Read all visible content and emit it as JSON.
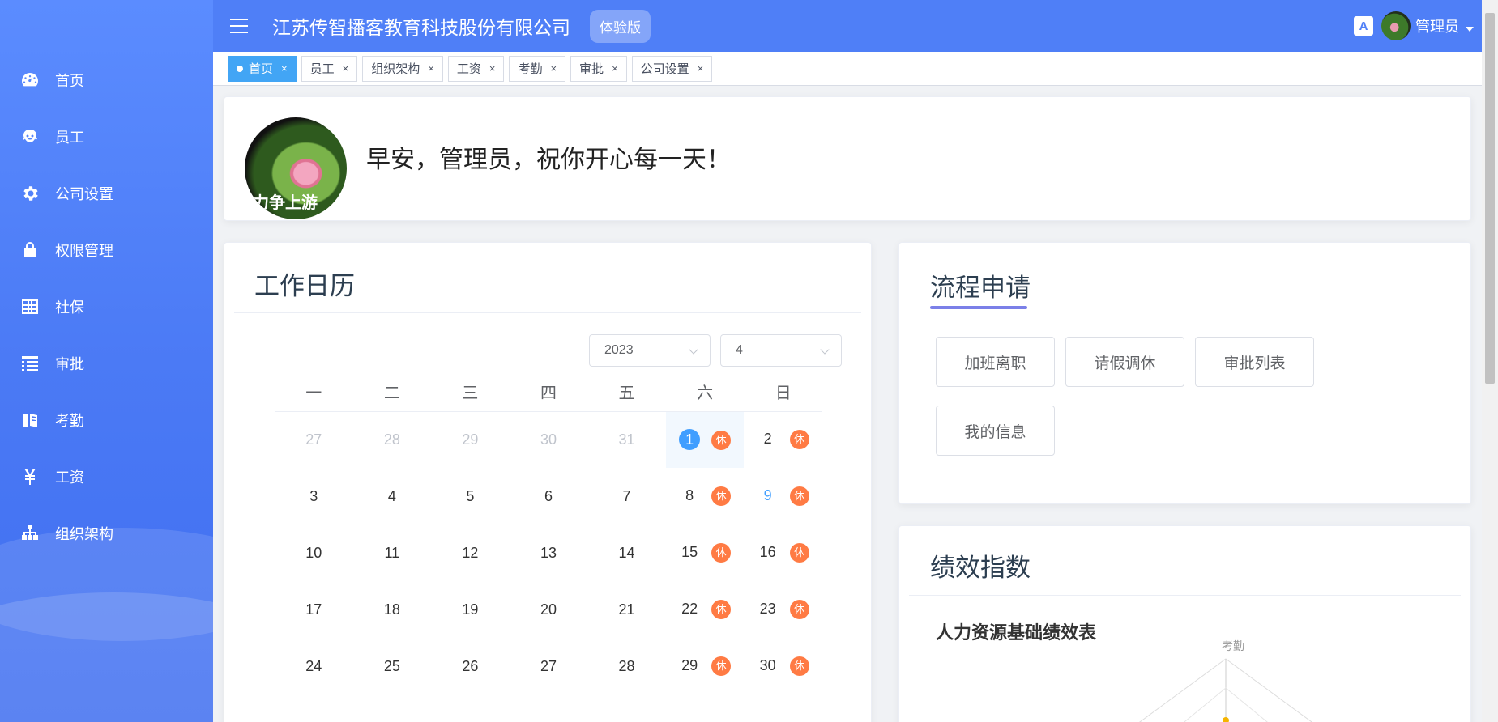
{
  "header": {
    "company": "江苏传智播客教育科技股份有限公司",
    "badge": "体验版",
    "username": "管理员",
    "lang_icon": "translate-icon"
  },
  "sidebar": {
    "items": [
      {
        "label": "首页",
        "icon": "dashboard-icon"
      },
      {
        "label": "员工",
        "icon": "people-icon"
      },
      {
        "label": "公司设置",
        "icon": "gear-icon"
      },
      {
        "label": "权限管理",
        "icon": "lock-icon"
      },
      {
        "label": "社保",
        "icon": "table-icon"
      },
      {
        "label": "审批",
        "icon": "tree-table-icon"
      },
      {
        "label": "考勤",
        "icon": "skill-icon"
      },
      {
        "label": "工资",
        "icon": "money-icon"
      },
      {
        "label": "组织架构",
        "icon": "tree-icon"
      }
    ]
  },
  "tags": [
    {
      "label": "首页",
      "active": true
    },
    {
      "label": "员工"
    },
    {
      "label": "组织架构"
    },
    {
      "label": "工资"
    },
    {
      "label": "考勤"
    },
    {
      "label": "审批"
    },
    {
      "label": "公司设置"
    }
  ],
  "welcome": {
    "avatar_text": "力争上游",
    "greeting": "早安，管理员，祝你开心每一天！"
  },
  "calendar": {
    "title": "工作日历",
    "year": "2023",
    "month": "4",
    "weekdays": [
      "一",
      "二",
      "三",
      "四",
      "五",
      "六",
      "日"
    ],
    "rest_label": "休",
    "weeks": [
      [
        {
          "d": "27",
          "prev": true
        },
        {
          "d": "28",
          "prev": true
        },
        {
          "d": "29",
          "prev": true
        },
        {
          "d": "30",
          "prev": true
        },
        {
          "d": "31",
          "prev": true
        },
        {
          "d": "1",
          "rest": true,
          "today": true
        },
        {
          "d": "2",
          "rest": true
        }
      ],
      [
        {
          "d": "3"
        },
        {
          "d": "4"
        },
        {
          "d": "5"
        },
        {
          "d": "6"
        },
        {
          "d": "7"
        },
        {
          "d": "8",
          "rest": true
        },
        {
          "d": "9",
          "rest": true,
          "blue": true
        }
      ],
      [
        {
          "d": "10"
        },
        {
          "d": "11"
        },
        {
          "d": "12"
        },
        {
          "d": "13"
        },
        {
          "d": "14"
        },
        {
          "d": "15",
          "rest": true
        },
        {
          "d": "16",
          "rest": true
        }
      ],
      [
        {
          "d": "17"
        },
        {
          "d": "18"
        },
        {
          "d": "19"
        },
        {
          "d": "20"
        },
        {
          "d": "21"
        },
        {
          "d": "22",
          "rest": true
        },
        {
          "d": "23",
          "rest": true
        }
      ],
      [
        {
          "d": "24"
        },
        {
          "d": "25"
        },
        {
          "d": "26"
        },
        {
          "d": "27"
        },
        {
          "d": "28"
        },
        {
          "d": "29",
          "rest": true
        },
        {
          "d": "30",
          "rest": true
        }
      ]
    ]
  },
  "flow": {
    "title": "流程申请",
    "buttons": [
      "加班离职",
      "请假调休",
      "审批列表",
      "我的信息"
    ]
  },
  "performance": {
    "title": "绩效指数",
    "subtitle": "人力资源基础绩效表",
    "radar_axis_top": "考勤"
  },
  "colors": {
    "primary": "#4f7ff7",
    "rest_badge": "#ff7b44",
    "today": "#409eff"
  }
}
